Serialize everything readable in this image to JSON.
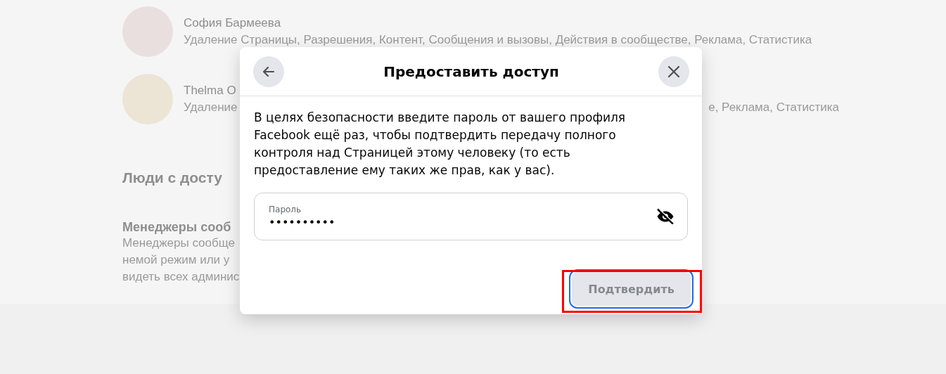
{
  "people": [
    {
      "name": "София Бармеева",
      "permissions": "Удаление Страницы, Разрешения, Контент, Сообщения и вызовы, Действия в сообществе, Реклама, Статистика"
    },
    {
      "name": "Thelma O",
      "permissions": "Удаление",
      "permissions_tail": "е, Реклама, Статистика"
    }
  ],
  "section": {
    "heading": "Люди с досту",
    "subheading": "Менеджеры сооб",
    "lines": [
      "Менеджеры сообще",
      "немой режим или у",
      "видеть всех админис"
    ]
  },
  "dialog": {
    "title": "Предоставить доступ",
    "message": "В целях безопасности введите пароль от вашего профиля Facebook ещё раз, чтобы подтвердить передачу полного контроля над Страницей этому человеку (то есть предоставление ему таких же прав, как у вас).",
    "password": {
      "label": "Пароль",
      "value": "••••••••••",
      "hidden": true
    },
    "confirm_button": {
      "label": "Подтвердить",
      "disabled": true,
      "focused": true,
      "highlighted": true
    }
  }
}
